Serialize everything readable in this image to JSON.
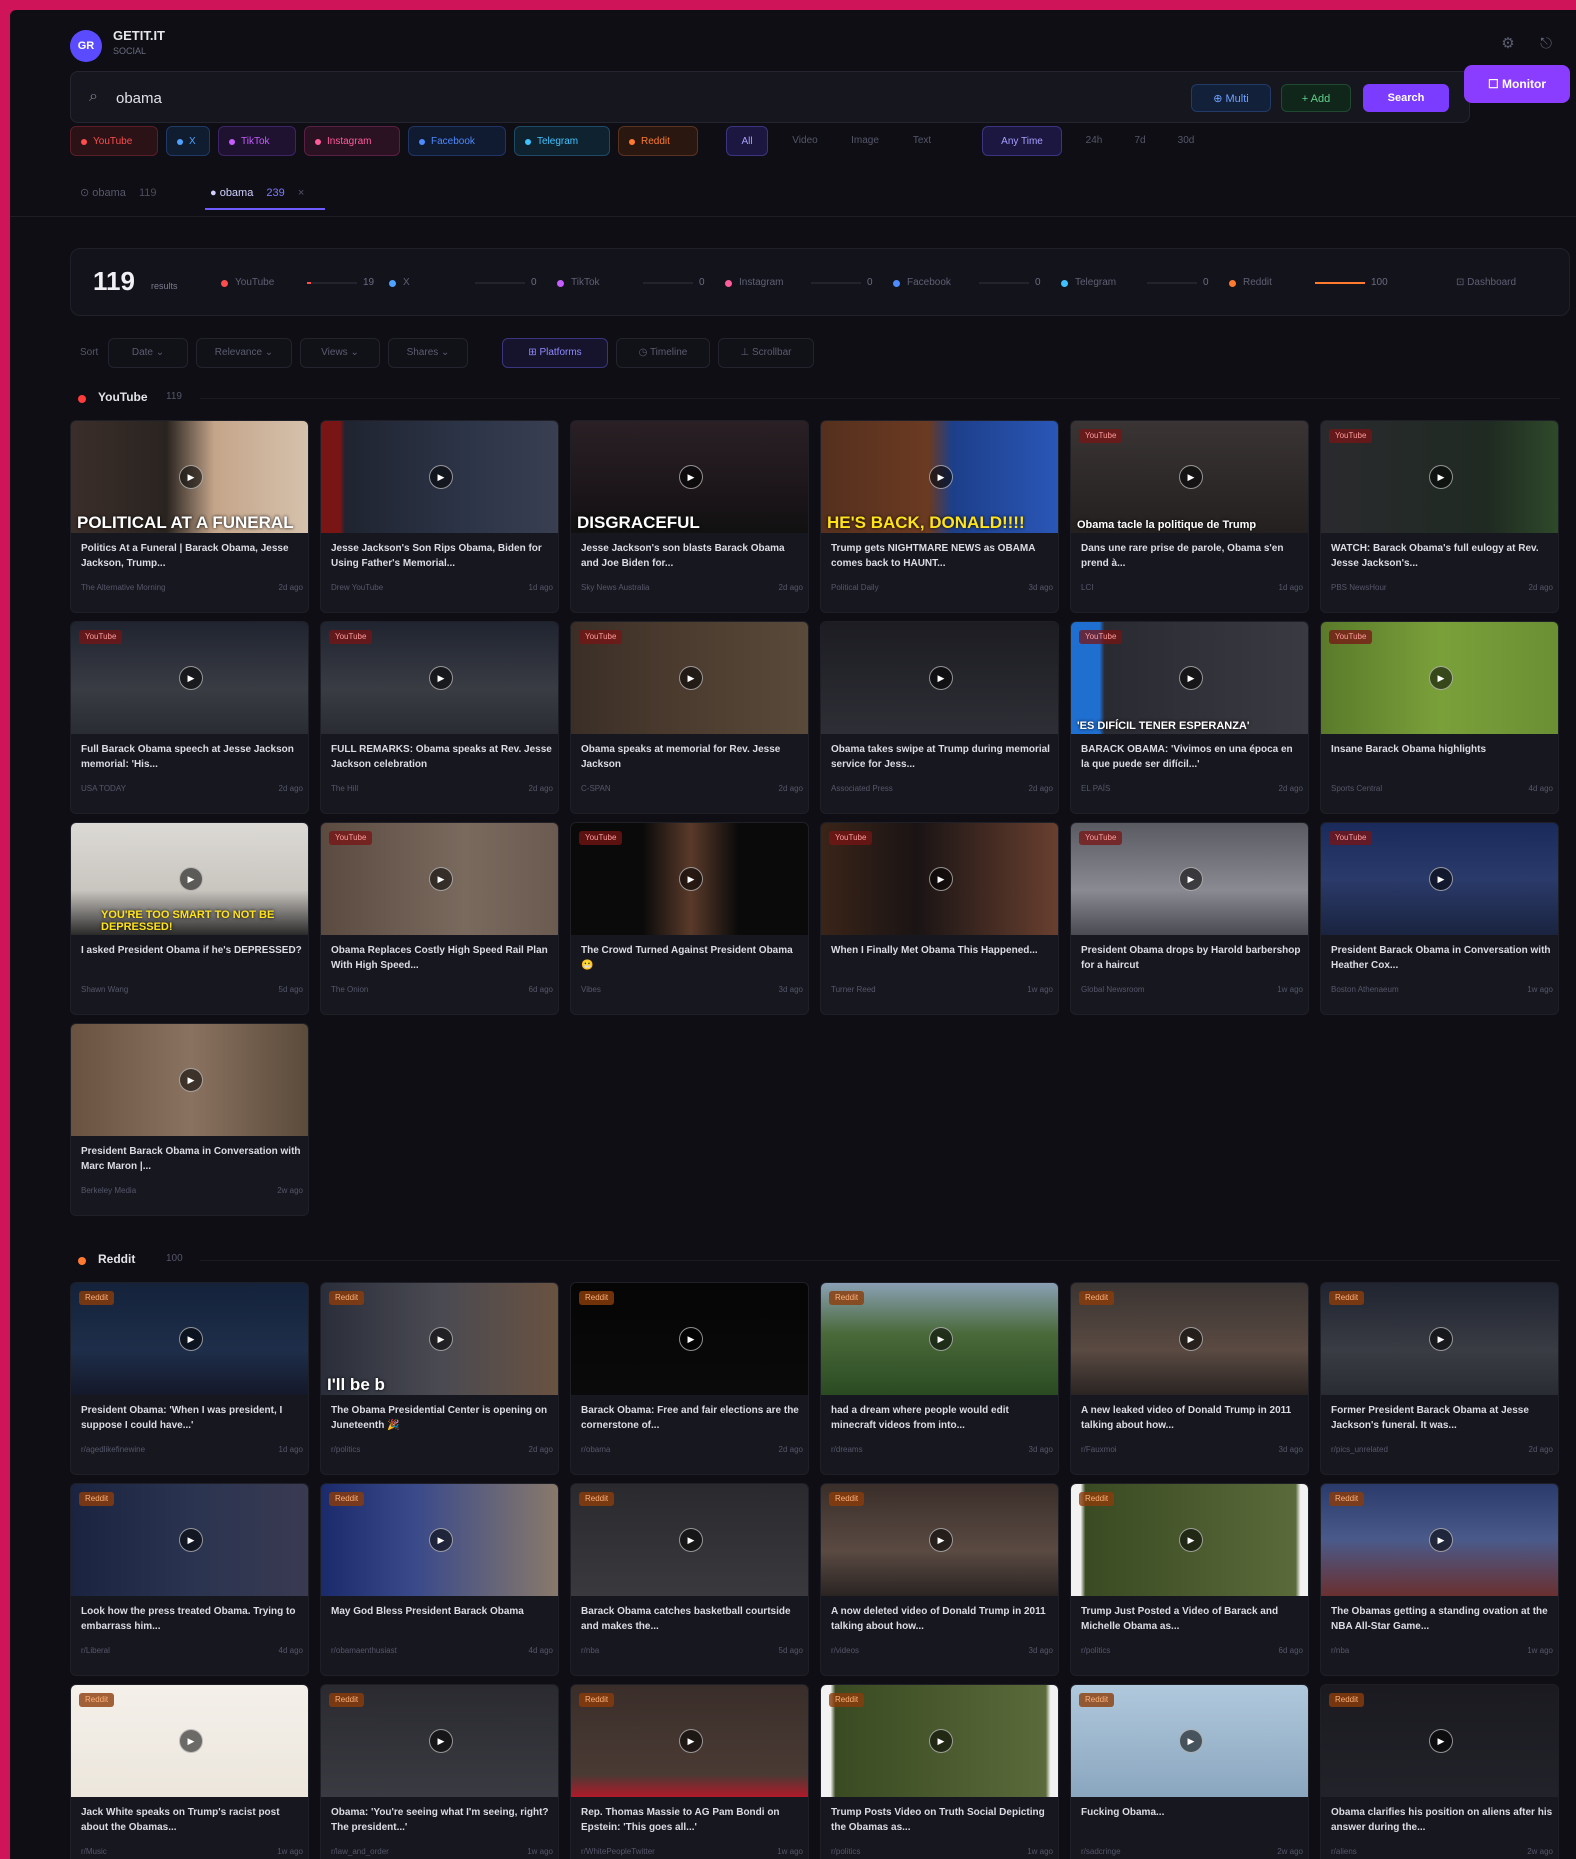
{
  "app": {
    "logo": "GR",
    "name": "GETIT.IT",
    "subtitle": "SOCIAL"
  },
  "search": {
    "value": "obama",
    "placeholder": "Search",
    "multi_label": "⊕ Multi",
    "add_label": "+ Add",
    "search_label": "Search",
    "monitor_label": "☐ Monitor"
  },
  "platform_chips": [
    {
      "label": "YouTube",
      "color": "#ff4d4d",
      "bg": "#2a1216",
      "border": "#5a1f26"
    },
    {
      "label": "X",
      "color": "#4da3ff",
      "bg": "#101c30",
      "border": "#1f3a66"
    },
    {
      "label": "TikTok",
      "color": "#c75cff",
      "bg": "#1e1230",
      "border": "#3d2466"
    },
    {
      "label": "Instagram",
      "color": "#ff5c9c",
      "bg": "#2a1222",
      "border": "#5a1f44"
    },
    {
      "label": "Facebook",
      "color": "#4d8bff",
      "bg": "#101a30",
      "border": "#1f3566"
    },
    {
      "label": "Telegram",
      "color": "#3fc3ff",
      "bg": "#0f2230",
      "border": "#1f4a66"
    },
    {
      "label": "Reddit",
      "color": "#ff7a2f",
      "bg": "#2a1810",
      "border": "#5a3220"
    }
  ],
  "type_filters": {
    "all": "All",
    "video": "Video",
    "image": "Image",
    "text": "Text"
  },
  "time_filters": {
    "any": "Any Time",
    "h24": "24h",
    "d7": "7d",
    "d30": "30d"
  },
  "tabs": [
    {
      "label": "⊙ obama",
      "count": "119"
    },
    {
      "label": "● obama",
      "count": "239"
    }
  ],
  "stats": {
    "total": "119",
    "total_label": "results",
    "dashboard_label": "⊡ Dashboard",
    "platforms": [
      {
        "name": "YouTube",
        "color": "#ff4d4d",
        "count": "19",
        "fill": 0.08
      },
      {
        "name": "X",
        "color": "#4da3ff",
        "count": "0",
        "fill": 0
      },
      {
        "name": "TikTok",
        "color": "#c75cff",
        "count": "0",
        "fill": 0
      },
      {
        "name": "Instagram",
        "color": "#ff5c9c",
        "count": "0",
        "fill": 0
      },
      {
        "name": "Facebook",
        "color": "#4d8bff",
        "count": "0",
        "fill": 0
      },
      {
        "name": "Telegram",
        "color": "#3fc3ff",
        "count": "0",
        "fill": 0
      },
      {
        "name": "Reddit",
        "color": "#ff7a2f",
        "count": "100",
        "fill": 1.0
      }
    ]
  },
  "sort": {
    "label": "Sort",
    "options": [
      "Date ⌄",
      "Relevance ⌄",
      "Views ⌄",
      "Shares ⌄"
    ],
    "views": [
      "⊞ Platforms",
      "◷ Timeline",
      "⊥ Scrollbar"
    ]
  },
  "sections": [
    {
      "name": "YouTube",
      "count": "119",
      "color": "#ff3b3b",
      "cards": [
        {
          "title": "Politics At a Funeral | Barack Obama, Jesse Jackson, Trump...",
          "channel": "The Alternative Morning",
          "meta": "2d ago",
          "badge": "",
          "caption": "POLITICAL AT A FUNERAL",
          "bg": "linear-gradient(90deg,#3b2e2a 0%,#2a2420 40%,#c4a58a 60%,#d6c2ad 100%)"
        },
        {
          "title": "Jesse Jackson's Son Rips Obama, Biden for Using Father's Memorial...",
          "channel": "Drew YouTube",
          "meta": "1d ago",
          "badge": "",
          "caption": "",
          "bg": "linear-gradient(90deg,#7a1515 0%,#7a1515 8%,#1f2430 10%,#2c3447 60%,#3a3f52 100%)"
        },
        {
          "title": "Jesse Jackson's son blasts Barack Obama and Joe Biden for...",
          "channel": "Sky News Australia",
          "meta": "2d ago",
          "badge": "",
          "caption": "DISGRACEFUL",
          "bg": "linear-gradient(180deg,#2a2025 0%,#1a1418 70%,#111 100%)"
        },
        {
          "title": "Trump gets NIGHTMARE NEWS as OBAMA comes back to HAUNT...",
          "channel": "Political Daily",
          "meta": "3d ago",
          "badge": "",
          "caption": "HE'S BACK, DONALD!!!!",
          "bg": "linear-gradient(90deg,#55301e 0%,#6b3a22 45%,#1d3f8a 55%,#2a57b8 100%)"
        },
        {
          "title": "Dans une rare prise de parole, Obama s'en prend à...",
          "channel": "LCI",
          "meta": "1d ago",
          "badge": "YouTube",
          "caption": "Obama tacle la politique de Trump",
          "bg": "linear-gradient(180deg,#3a3434 0%,#242020 100%)"
        },
        {
          "title": "WATCH: Barack Obama's full eulogy at Rev. Jesse Jackson's...",
          "channel": "PBS NewsHour",
          "meta": "2d ago",
          "badge": "YouTube",
          "caption": "",
          "bg": "linear-gradient(90deg,#2a2a2e 0%,#1f2a22 70%,#2f4a2a 100%)"
        },
        {
          "title": "Full Barack Obama speech at Jesse Jackson memorial: 'His...",
          "channel": "USA TODAY",
          "meta": "2d ago",
          "badge": "YouTube",
          "caption": "",
          "bg": "linear-gradient(180deg,#1f2430 0%,#3a3c44 60%,#2a2c34 100%)"
        },
        {
          "title": "FULL REMARKS: Obama speaks at Rev. Jesse Jackson celebration",
          "channel": "The Hill",
          "meta": "2d ago",
          "badge": "YouTube",
          "caption": "",
          "bg": "linear-gradient(180deg,#1f2430 0%,#3a3c44 60%,#2a2c34 100%)"
        },
        {
          "title": "Obama speaks at memorial for Rev. Jesse Jackson",
          "channel": "C-SPAN",
          "meta": "2d ago",
          "badge": "YouTube",
          "caption": "",
          "bg": "linear-gradient(90deg,#3a2e26 0%,#4a3a2e 40%,#5a4a3a 100%)"
        },
        {
          "title": "Obama takes swipe at Trump during memorial service for Jess...",
          "channel": "Associated Press",
          "meta": "2d ago",
          "badge": "",
          "caption": "",
          "bg": "linear-gradient(180deg,#1c1c22 0%,#2e2e36 100%)"
        },
        {
          "title": "BARACK OBAMA: 'Vivimos en una época en la que puede ser difícil...'",
          "channel": "EL PAÍS",
          "meta": "2d ago",
          "badge": "YouTube",
          "caption": "'ES DIFÍCIL TENER ESPERANZA'",
          "bg": "linear-gradient(90deg,#1f6fd1 0%,#1f6fd1 12%,#2a2a32 14%,#3a3a42 100%)"
        },
        {
          "title": "Insane Barack Obama highlights",
          "channel": "Sports Central",
          "meta": "4d ago",
          "badge": "YouTube",
          "caption": "",
          "bg": "linear-gradient(90deg,#5a7a2a 0%,#7aa03a 50%,#6a8f34 100%)"
        },
        {
          "title": "I asked President Obama if he's DEPRESSED?",
          "channel": "Shawn Wang",
          "meta": "5d ago",
          "badge": "",
          "caption": "YOU'RE TOO SMART TO NOT BE DEPRESSED!",
          "bg": "linear-gradient(180deg,#dcdad6 0%,#c9c5bf 60%,#2a2a2a 100%)"
        },
        {
          "title": "Obama Replaces Costly High Speed Rail Plan With High Speed...",
          "channel": "The Onion",
          "meta": "6d ago",
          "badge": "YouTube",
          "caption": "",
          "bg": "linear-gradient(90deg,#5a4a40 0%,#7a6a5e 60%,#6a5a50 100%)"
        },
        {
          "title": "The Crowd Turned Against President Obama 😬",
          "channel": "Vibes",
          "meta": "3d ago",
          "badge": "YouTube",
          "caption": "",
          "bg": "linear-gradient(90deg,#0a0a0a 0%,#0a0a0a 30%,#5a3a2a 50%,#0a0a0a 70%)"
        },
        {
          "title": "When I Finally Met Obama This Happened...",
          "channel": "Turner Reed",
          "meta": "1w ago",
          "badge": "YouTube",
          "caption": "",
          "bg": "linear-gradient(90deg,#3a2418 0%,#1a1414 40%,#6a4030 100%)"
        },
        {
          "title": "President Obama drops by Harold barbershop for a haircut",
          "channel": "Global Newsroom",
          "meta": "1w ago",
          "badge": "YouTube",
          "caption": "",
          "bg": "linear-gradient(180deg,#5a5a62 0%,#8a8a92 60%,#4a4a52 100%)"
        },
        {
          "title": "President Barack Obama in Conversation with Heather Cox...",
          "channel": "Boston Athenaeum",
          "meta": "1w ago",
          "badge": "YouTube",
          "caption": "",
          "bg": "linear-gradient(180deg,#1a2a5a 0%,#2a3a6a 50%,#1a2440 100%)"
        },
        {
          "title": "President Barack Obama in Conversation with Marc Maron |...",
          "channel": "Berkeley Media",
          "meta": "2w ago",
          "badge": "",
          "caption": "",
          "bg": "linear-gradient(90deg,#6a5240 0%,#8a7260 50%,#5a4a3a 100%)"
        }
      ]
    },
    {
      "name": "Reddit",
      "count": "100",
      "color": "#ff7a2f",
      "cards": [
        {
          "title": "President Obama: 'When I was president, I suppose I could have...'",
          "channel": "r/agedlikefinewine",
          "meta": "1d ago",
          "badge": "Reddit",
          "caption": "",
          "bg": "linear-gradient(180deg,#14223a 0%,#1e2e4a 60%,#14182a 100%)"
        },
        {
          "title": "The Obama Presidential Center is opening on Juneteenth 🎉",
          "channel": "r/politics",
          "meta": "2d ago",
          "badge": "Reddit",
          "caption": "I'll be b",
          "bg": "linear-gradient(90deg,#2a2e3a 0%,#4a4a52 50%,#6a5240 100%)"
        },
        {
          "title": "Barack Obama: Free and fair elections are the cornerstone of...",
          "channel": "r/obama",
          "meta": "2d ago",
          "badge": "Reddit",
          "caption": "",
          "bg": "linear-gradient(180deg,#050505 0%,#0a0a0a 100%)"
        },
        {
          "title": "had a dream where people would edit minecraft videos from into...",
          "channel": "r/dreams",
          "meta": "3d ago",
          "badge": "Reddit",
          "caption": "",
          "bg": "linear-gradient(180deg,#8aa0b4 0%,#4a6a3a 45%,#2a4a22 100%)"
        },
        {
          "title": "A new leaked video of Donald Trump in 2011 talking about how...",
          "channel": "r/Fauxmoi",
          "meta": "3d ago",
          "badge": "Reddit",
          "caption": "",
          "bg": "linear-gradient(180deg,#3a3432 0%,#5a4a42 60%,#2a2422 100%)"
        },
        {
          "title": "Former President Barack Obama at Jesse Jackson's funeral. It was...",
          "channel": "r/pics_unrelated",
          "meta": "2d ago",
          "badge": "Reddit",
          "caption": "",
          "bg": "linear-gradient(180deg,#1f2430 0%,#3a3c44 60%,#2a2c34 100%)"
        },
        {
          "title": "Look how the press treated Obama. Trying to embarrass him...",
          "channel": "r/Liberal",
          "meta": "4d ago",
          "badge": "Reddit",
          "caption": "",
          "bg": "linear-gradient(90deg,#1a2440 0%,#2a3450 50%,#3a3a52 100%)"
        },
        {
          "title": "May God Bless President Barack Obama",
          "channel": "r/obamaenthusiast",
          "meta": "4d ago",
          "badge": "Reddit",
          "caption": "",
          "bg": "linear-gradient(90deg,#1a2a6a 0%,#3a4a8a 40%,#8a7a6a 100%)"
        },
        {
          "title": "Barack Obama catches basketball courtside and makes the...",
          "channel": "r/nba",
          "meta": "5d ago",
          "badge": "Reddit",
          "caption": "",
          "bg": "linear-gradient(180deg,#2a2a2e 0%,#3a3a3e 100%)"
        },
        {
          "title": "A now deleted video of Donald Trump in 2011 talking about how...",
          "channel": "r/videos",
          "meta": "3d ago",
          "badge": "Reddit",
          "caption": "",
          "bg": "linear-gradient(180deg,#3a2e2a 0%,#5a4a42 60%,#2a2422 100%)"
        },
        {
          "title": "Trump Just Posted a Video of Barack and Michelle Obama as...",
          "channel": "r/politics",
          "meta": "6d ago",
          "badge": "Reddit",
          "caption": "",
          "bg": "linear-gradient(90deg,#f2f2f2 0%,#f2f2f2 4%,#3a4a22 6%,#5a6a3a 94%,#f2f2f2 96%)"
        },
        {
          "title": "The Obamas getting a standing ovation at the NBA All-Star Game...",
          "channel": "r/nba",
          "meta": "1w ago",
          "badge": "Reddit",
          "caption": "",
          "bg": "linear-gradient(180deg,#2a3a6a 0%,#4a5a8a 50%,#6a3030 100%)"
        },
        {
          "title": "Jack White speaks on Trump's racist post about the Obamas...",
          "channel": "r/Music",
          "meta": "1w ago",
          "badge": "Reddit",
          "caption": "",
          "bg": "linear-gradient(180deg,#f4f0ea 0%,#ece6dc 100%)"
        },
        {
          "title": "Obama: 'You're seeing what I'm seeing, right? The president...'",
          "channel": "r/law_and_order",
          "meta": "1w ago",
          "badge": "Reddit",
          "caption": "",
          "bg": "linear-gradient(180deg,#2a2a30 0%,#3a3a42 100%)"
        },
        {
          "title": "Rep. Thomas Massie to AG Pam Bondi on Epstein: 'This goes all...'",
          "channel": "r/WhitePeopleTwitter",
          "meta": "1w ago",
          "badge": "Reddit",
          "caption": "",
          "bg": "linear-gradient(180deg,#3a2e2a 0%,#4a3a34 80%,#b01a2a 100%)"
        },
        {
          "title": "Trump Posts Video on Truth Social Depicting the Obamas as...",
          "channel": "r/politics",
          "meta": "1w ago",
          "badge": "Reddit",
          "caption": "",
          "bg": "linear-gradient(90deg,#f2f2f2 0%,#f2f2f2 4%,#3a4a22 6%,#5a6a3a 94%,#f2f2f2 96%)"
        },
        {
          "title": "Fucking Obama...",
          "channel": "r/sadcringe",
          "meta": "2w ago",
          "badge": "Reddit",
          "caption": "",
          "bg": "linear-gradient(180deg,#b0c8dc 0%,#8aa6bf 100%)"
        },
        {
          "title": "Obama clarifies his position on aliens after his answer during the...",
          "channel": "r/aliens",
          "meta": "2w ago",
          "badge": "Reddit",
          "caption": "",
          "bg": "linear-gradient(180deg,#1a1a20 0%,#22222a 100%)"
        }
      ]
    }
  ]
}
